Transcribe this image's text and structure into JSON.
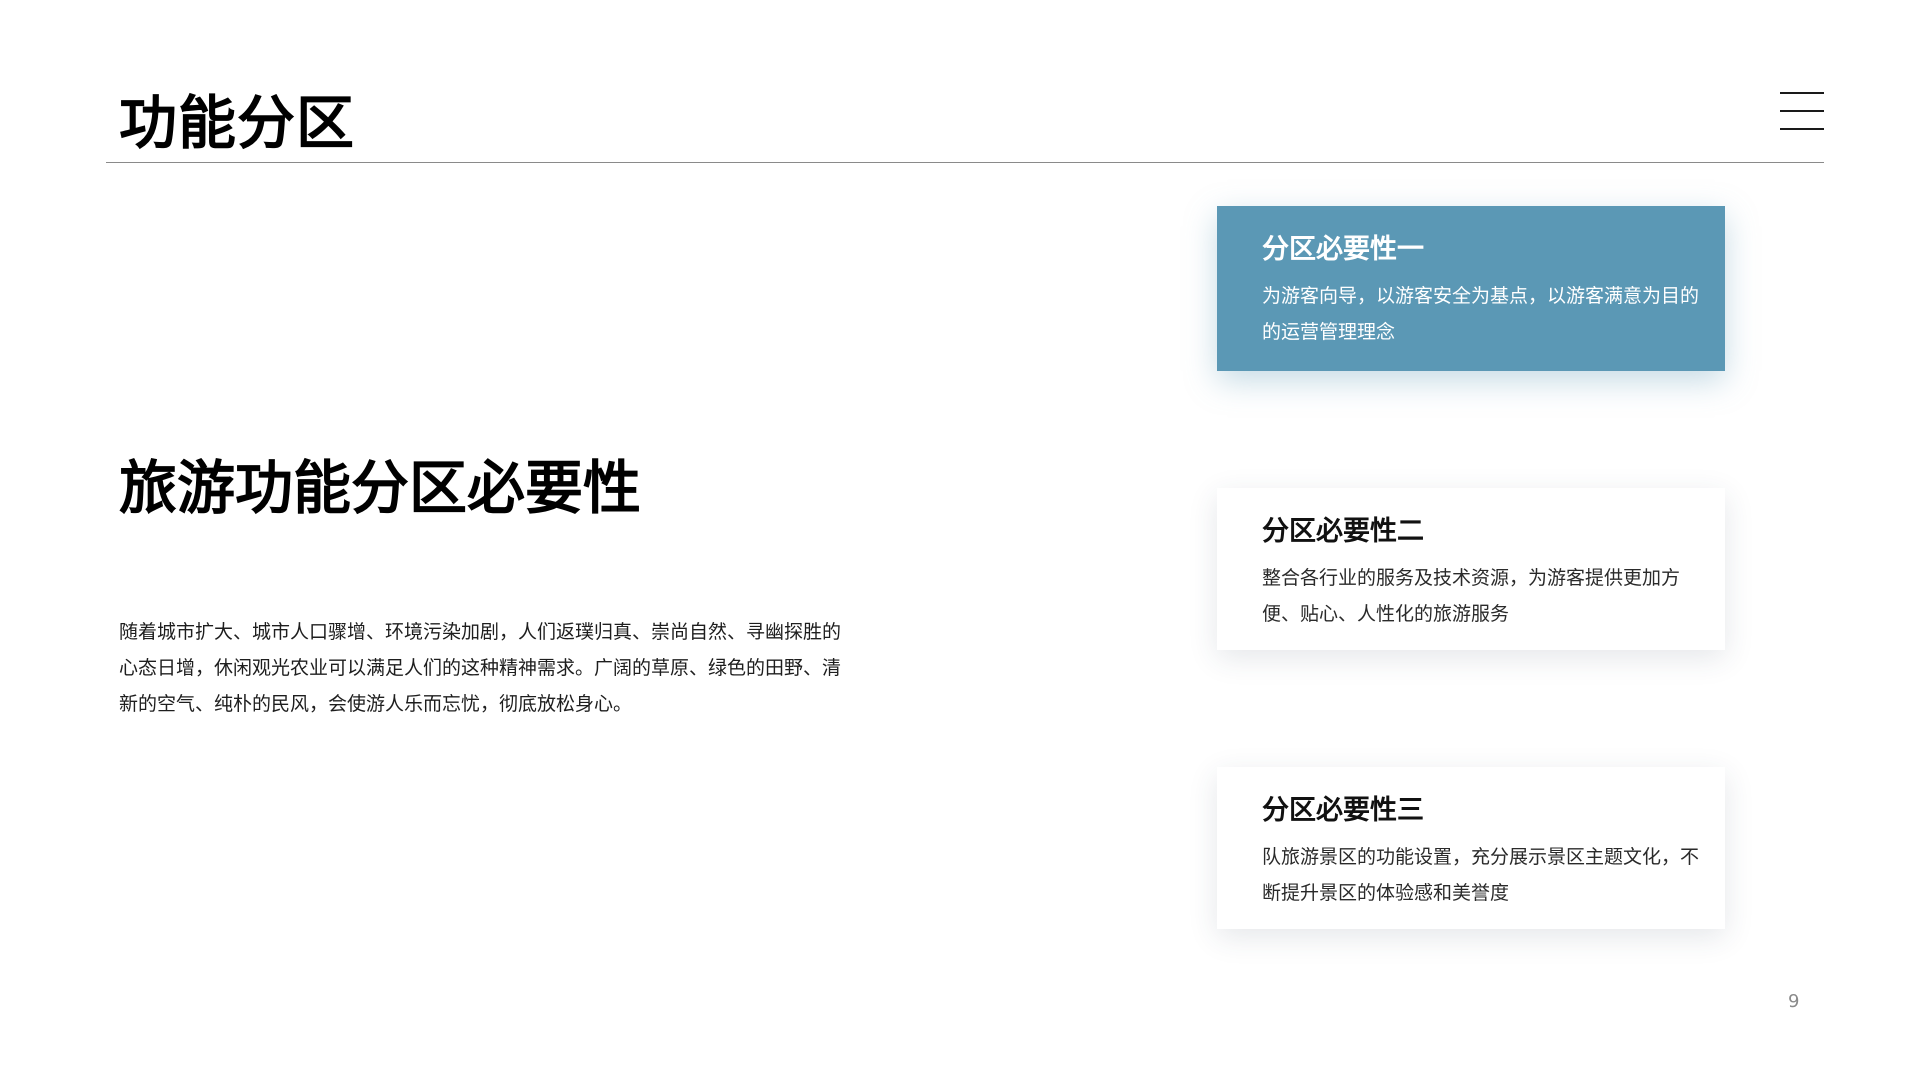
{
  "header": {
    "title": "功能分区"
  },
  "main": {
    "heading": "旅游功能分区必要性",
    "body": "随着城市扩大、城市人口骤增、环境污染加剧，人们返璞归真、崇尚自然、寻幽探胜的心态日增，休闲观光农业可以满足人们的这种精神需求。广阔的草原、绿色的田野、清新的空气、纯朴的民风，会使游人乐而忘忧，彻底放松身心。"
  },
  "cards": [
    {
      "title": "分区必要性一",
      "text": "为游客向导，以游客安全为基点，以游客满意为目的的运营管理理念",
      "active": true
    },
    {
      "title": "分区必要性二",
      "text": "整合各行业的服务及技术资源，为游客提供更加方便、贴心、人性化的旅游服务",
      "active": false
    },
    {
      "title": "分区必要性三",
      "text": "队旅游景区的功能设置，充分展示景区主题文化，不断提升景区的体验感和美誉度",
      "active": false
    }
  ],
  "footer": {
    "page_number": "9"
  },
  "colors": {
    "accent": "#5b98b5",
    "title": "#000000",
    "body_text": "#1e1e1e",
    "rule": "#8a8a8a"
  },
  "icons": {
    "menu": "hamburger-menu-icon"
  }
}
